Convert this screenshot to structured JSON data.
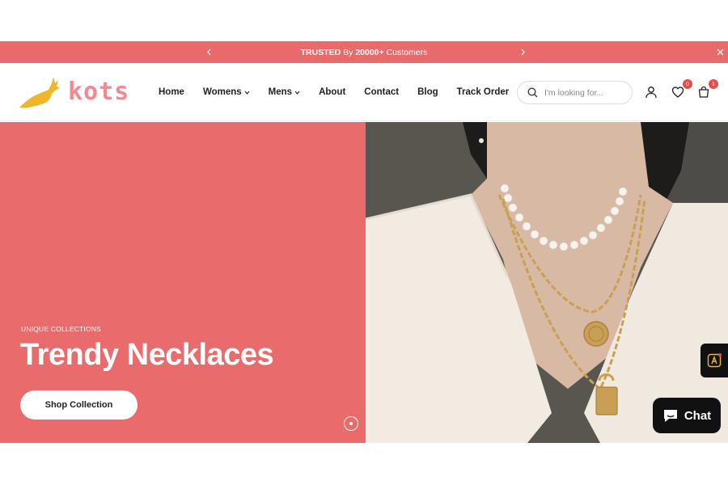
{
  "announcement": {
    "prefix": "TRUSTED",
    "middle": " By ",
    "count": "20000+",
    "suffix": " Customers"
  },
  "brand": {
    "name": "kots",
    "logo_color": "#f0b629",
    "text_color": "#ef8a92"
  },
  "nav": {
    "items": [
      {
        "label": "Home",
        "has_dropdown": false
      },
      {
        "label": "Womens",
        "has_dropdown": true
      },
      {
        "label": "Mens",
        "has_dropdown": true
      },
      {
        "label": "About",
        "has_dropdown": false
      },
      {
        "label": "Contact",
        "has_dropdown": false
      },
      {
        "label": "Blog",
        "has_dropdown": false
      },
      {
        "label": "Track Order",
        "has_dropdown": false
      }
    ]
  },
  "search": {
    "placeholder": "I'm looking for..."
  },
  "header_icons": {
    "account": "user-icon",
    "wishlist": "heart-icon",
    "wishlist_count": "0",
    "cart": "cart-icon",
    "cart_count": "1"
  },
  "hero": {
    "eyebrow": "UNIQUE COLLECTIONS",
    "title": "Trendy Necklaces",
    "cta_label": "Shop Collection",
    "background_color": "#ea6b6c"
  },
  "chat": {
    "label": "Chat"
  },
  "colors": {
    "accent": "#e96a6a",
    "badge": "#e44c4c"
  }
}
